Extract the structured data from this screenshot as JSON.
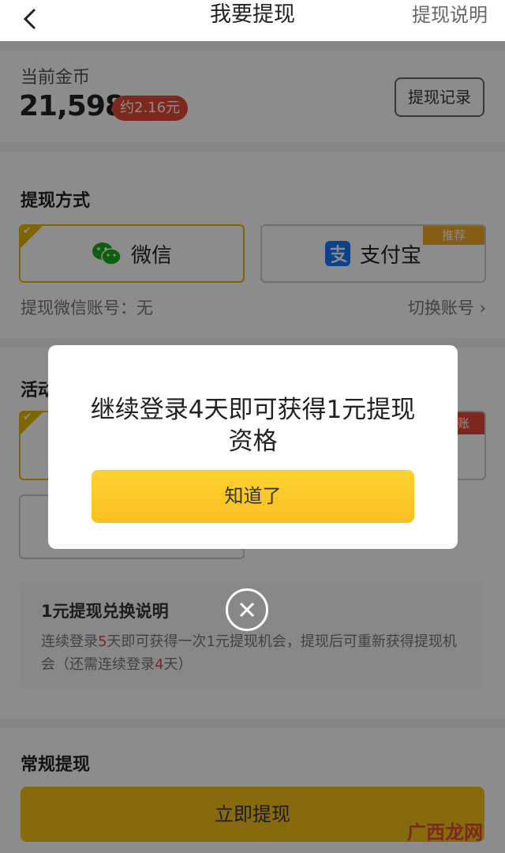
{
  "nav": {
    "title": "我要提现",
    "help": "提现说明"
  },
  "coins": {
    "label": "当前金币",
    "value": "21,598",
    "approx": "约2.16元",
    "record_button": "提现记录"
  },
  "method": {
    "title": "提现方式",
    "wechat": "微信",
    "alipay": "支付宝",
    "recommend_badge": "推荐",
    "account_label": "提现微信账号：无",
    "switch_account": "切换账号"
  },
  "activity": {
    "title_visible": "活动",
    "arrive_badge": "到账",
    "explain_title": "1元提现兑换说明",
    "explain_pre": "连续登录",
    "explain_days": "5",
    "explain_mid": "天即可获得一次1元提现机会，提现后可重新获得提现机会（还需连续登录",
    "explain_remaining": "4",
    "explain_post": "天）"
  },
  "regular": {
    "title": "常规提现",
    "button": "立即提现"
  },
  "watermark": "广西龙网",
  "dialog": {
    "message": "继续登录4天即可获得1元提现资格",
    "button": "知道了"
  },
  "colors": {
    "accent": "#f5c116",
    "red": "#e24a3a",
    "wechat_green": "#1aad19",
    "alipay_blue": "#1677ff"
  }
}
